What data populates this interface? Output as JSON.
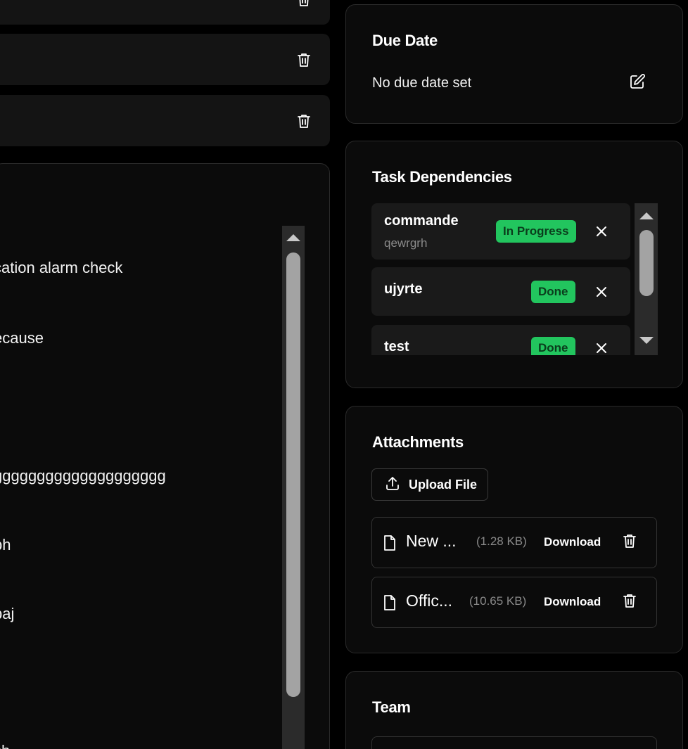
{
  "left": {
    "comments": [
      "cation alarm check",
      "ecause",
      "gggggggggggggggggggg",
      "ph",
      "paj",
      "ch"
    ]
  },
  "due_date": {
    "title": "Due Date",
    "value": "No due date set"
  },
  "dependencies": {
    "title": "Task Dependencies",
    "items": [
      {
        "name": "commande",
        "sub": "qewrgrh",
        "status": "In Progress"
      },
      {
        "name": "ujyrte",
        "sub": "",
        "status": "Done"
      },
      {
        "name": "test",
        "sub": "",
        "status": "Done"
      }
    ]
  },
  "attachments": {
    "title": "Attachments",
    "upload_label": "Upload File",
    "files": [
      {
        "name": "New ...",
        "size": "(1.28 KB)",
        "download_label": "Download"
      },
      {
        "name": "Offic...",
        "size": "(10.65 KB)",
        "download_label": "Download"
      }
    ]
  },
  "team": {
    "title": "Team"
  },
  "colors": {
    "badge_green": "#22c55e",
    "background": "#000000",
    "card": "#0b0b0b"
  }
}
